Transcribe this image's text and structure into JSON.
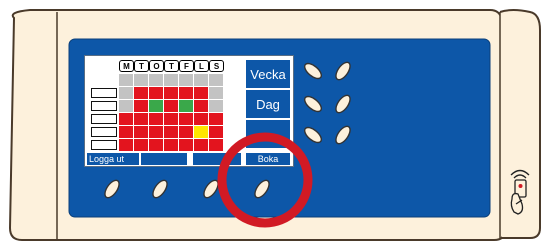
{
  "screen": {
    "day_headers": [
      "M",
      "T",
      "O",
      "T",
      "F",
      "L",
      "S"
    ],
    "grid": [
      [
        "grey",
        "grey",
        "grey",
        "grey",
        "grey",
        "grey",
        "grey"
      ],
      [
        "grey",
        "red",
        "red",
        "red",
        "red",
        "red",
        "grey"
      ],
      [
        "grey",
        "red",
        "green",
        "red",
        "green",
        "red",
        "grey"
      ],
      [
        "red",
        "red",
        "red",
        "red",
        "red",
        "red",
        "red"
      ],
      [
        "red",
        "red",
        "red",
        "red",
        "red",
        "yellow",
        "red"
      ],
      [
        "red",
        "red",
        "red",
        "red",
        "red",
        "red",
        "red"
      ]
    ],
    "side_buttons": [
      "Vecka",
      "Dag",
      ""
    ],
    "bottom_buttons": [
      "Logga ut",
      "",
      "",
      "Boka"
    ]
  },
  "colors": {
    "panel_blue": "#0d57a8",
    "frame_cream": "#fdf1dc",
    "grid_grey": "#c3c3c3",
    "grid_red": "#e3141e",
    "grid_green": "#3aa84a",
    "grid_yellow": "#ffe600",
    "highlight_ring": "#d11a24"
  }
}
